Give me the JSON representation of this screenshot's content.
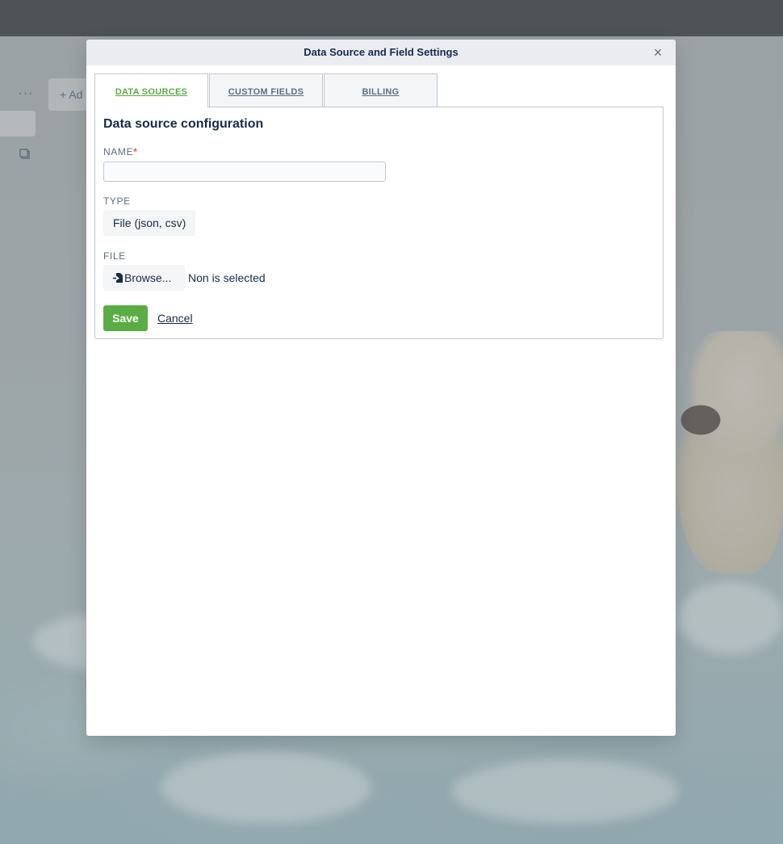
{
  "background": {
    "more_glyph": "···",
    "add_label": "+ Ad",
    "copy_icon": "copy-icon"
  },
  "modal": {
    "title": "Data Source and Field Settings",
    "close_glyph": "×"
  },
  "tabs": [
    {
      "label": "DATA SOURCES",
      "active": true
    },
    {
      "label": "CUSTOM FIELDS",
      "active": false
    },
    {
      "label": "BILLING",
      "active": false
    }
  ],
  "form": {
    "heading": "Data source configuration",
    "name_label": "NAME",
    "required_mark": "*",
    "name_value": "",
    "name_placeholder": "",
    "type_label": "TYPE",
    "type_value": "File (json, csv)",
    "file_label": "FILE",
    "browse_label": "Browse...",
    "file_status": "Non is selected",
    "save_label": "Save",
    "cancel_label": "Cancel"
  },
  "colors": {
    "accent_green": "#5aac44",
    "required_red": "#eb5a46",
    "text": "#172b4d",
    "muted": "#5e6c84"
  }
}
